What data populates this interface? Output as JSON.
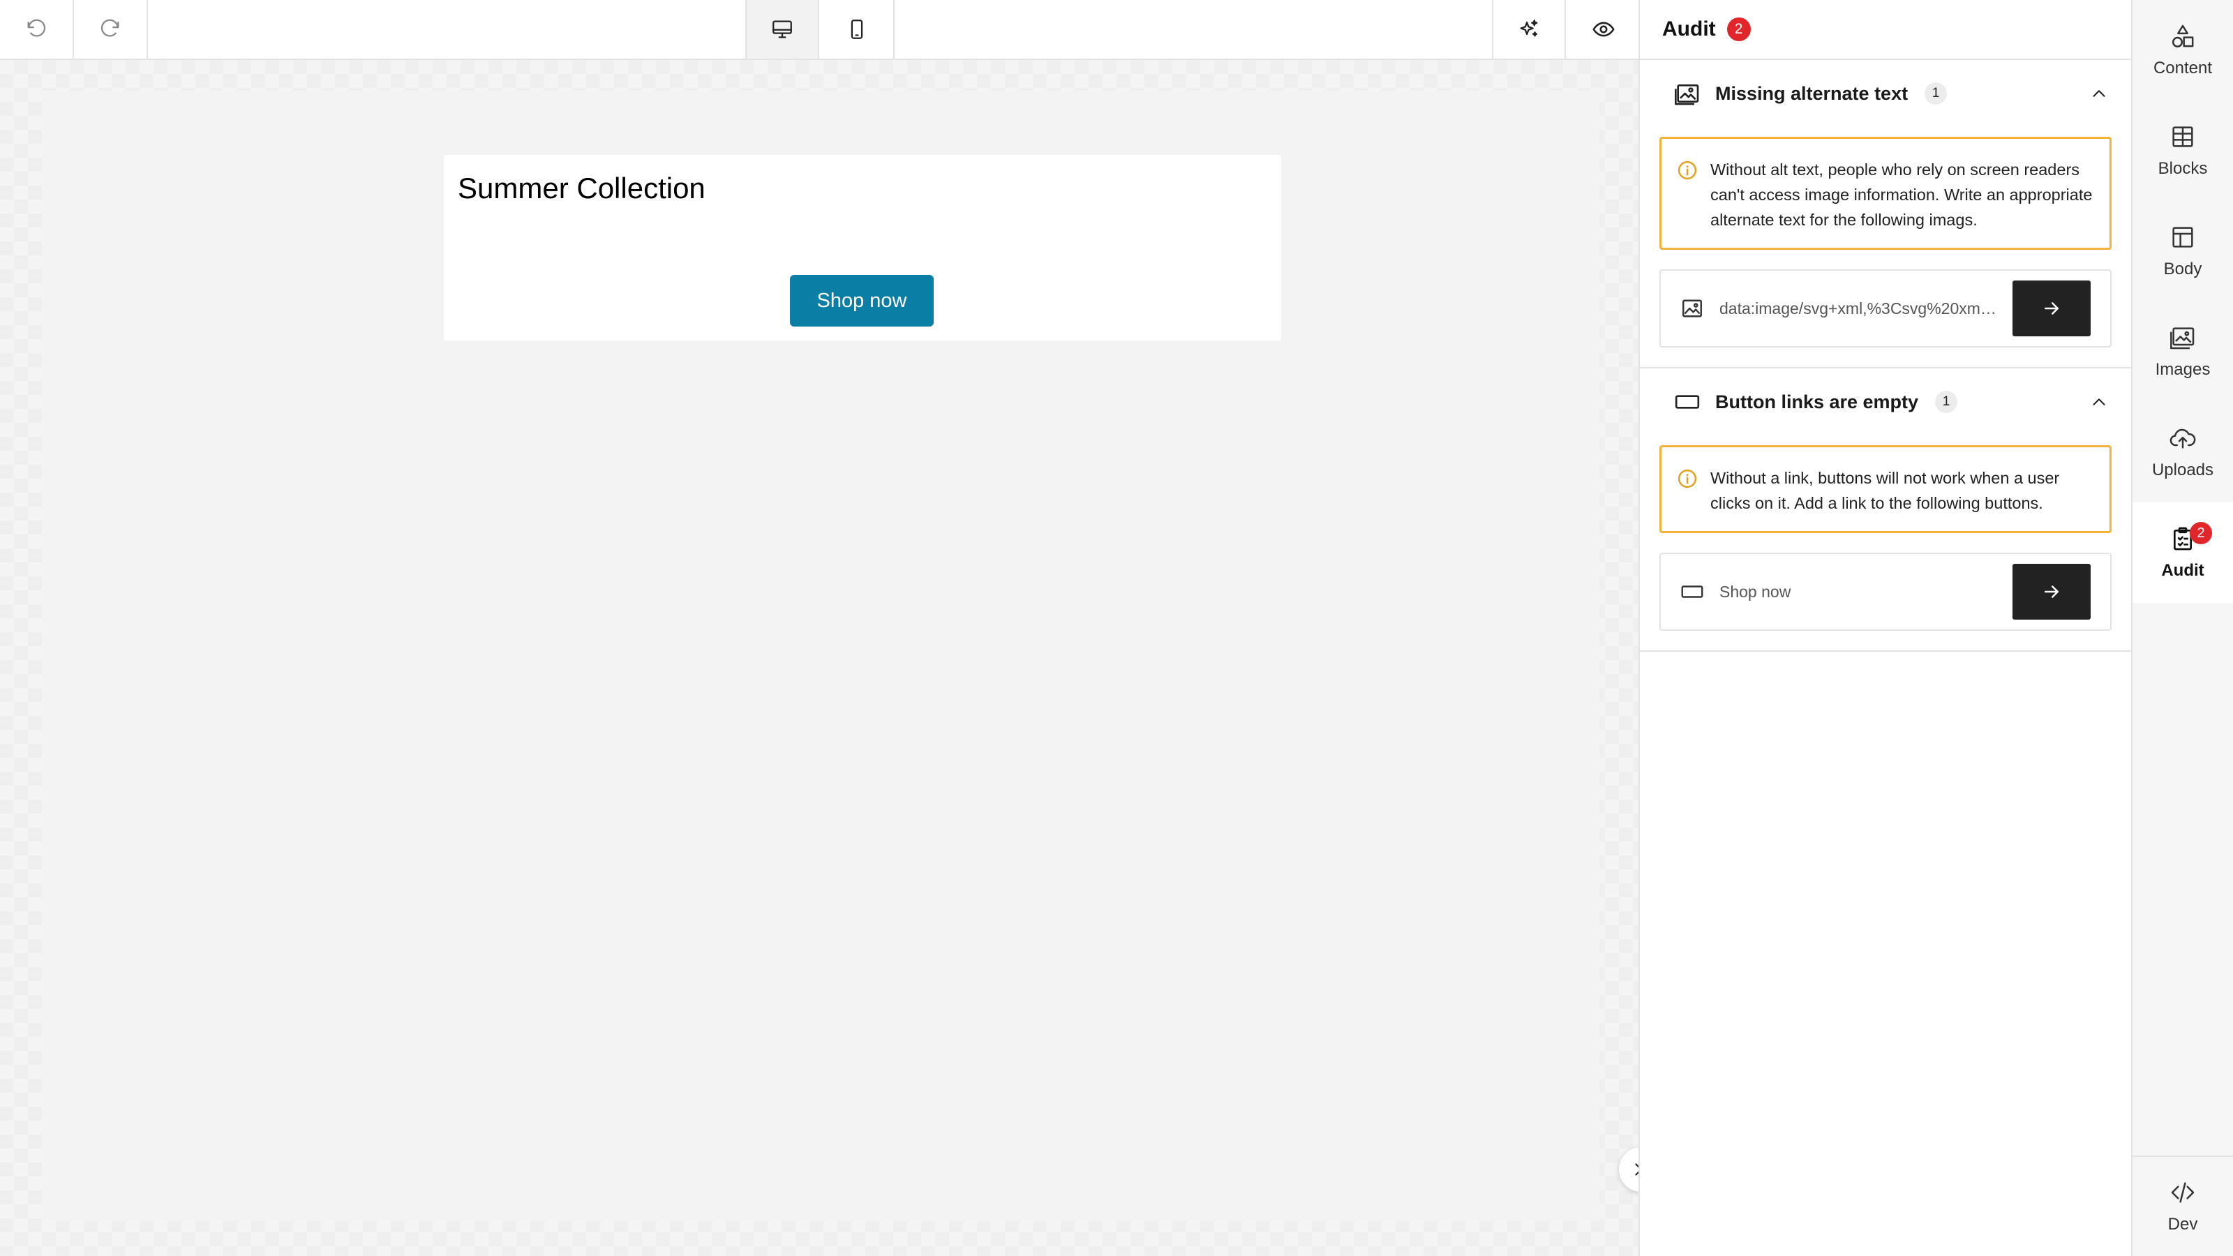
{
  "toolbar": {
    "undo_icon": "undo-icon",
    "redo_icon": "redo-icon",
    "desktop_icon": "desktop-icon",
    "mobile_icon": "mobile-icon",
    "ai_icon": "sparkle-icon",
    "preview_icon": "eye-icon"
  },
  "canvas": {
    "title": "Summer Collection",
    "button_label": "Shop now",
    "button_color": "#0a7ea4"
  },
  "panel": {
    "title": "Audit",
    "badge_count": "2",
    "sections": [
      {
        "title": "Missing alternate text",
        "count": "1",
        "icon": "image-icon",
        "warning": "Without alt text, people who rely on screen readers can't access image information. Write an appropriate alternate text for the following imags.",
        "item_text": "data:image/svg+xml,%3Csvg%20xmlns%3D%22http%3A%2F%2Fwww.w3.org",
        "item_icon": "image-icon"
      },
      {
        "title": "Button links are empty",
        "count": "1",
        "icon": "button-icon",
        "warning": "Without a link, buttons will not work when a user clicks on it. Add a link to the following buttons.",
        "item_text": "Shop now",
        "item_icon": "button-icon"
      }
    ]
  },
  "rail": {
    "items": [
      {
        "label": "Content",
        "icon": "shapes-icon"
      },
      {
        "label": "Blocks",
        "icon": "grid-icon"
      },
      {
        "label": "Body",
        "icon": "layout-icon"
      },
      {
        "label": "Images",
        "icon": "images-icon"
      },
      {
        "label": "Uploads",
        "icon": "cloud-upload-icon"
      },
      {
        "label": "Audit",
        "icon": "clipboard-check-icon",
        "badge": "2"
      }
    ],
    "bottom": {
      "label": "Dev",
      "icon": "code-icon"
    }
  },
  "colors": {
    "accent_warning": "#f2b23c",
    "badge_red": "#e0262a",
    "dark_button": "#222222"
  }
}
